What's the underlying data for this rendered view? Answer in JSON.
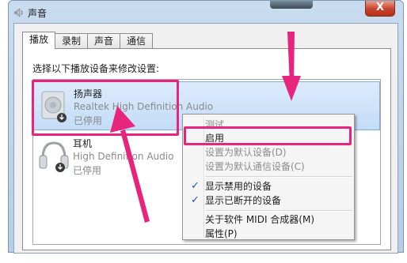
{
  "window": {
    "title": "声音",
    "close_label": "X"
  },
  "tabs": [
    {
      "label": "播放",
      "active": true
    },
    {
      "label": "录制",
      "active": false
    },
    {
      "label": "声音",
      "active": false
    },
    {
      "label": "通信",
      "active": false
    }
  ],
  "instruction": "选择以下播放设备来修改设置:",
  "devices": [
    {
      "name": "扬声器",
      "description": "Realtek High Definition Audio",
      "status": "已停用",
      "icon": "speaker-icon"
    },
    {
      "name": "耳机",
      "description": "High Definition Audio",
      "status": "已停用",
      "icon": "headphones-icon"
    }
  ],
  "context_menu": {
    "items": [
      {
        "label": "测试",
        "disabled": true
      },
      {
        "label": "启用",
        "disabled": false
      },
      {
        "label": "设置为默认设备(D)",
        "disabled": true
      },
      {
        "label": "设置为默认通信设备(C)",
        "disabled": true
      },
      {
        "label": "显示禁用的设备",
        "checked": true
      },
      {
        "label": "显示已断开的设备",
        "checked": true
      },
      {
        "label": "关于软件 MIDI 合成器(M)"
      },
      {
        "label": "属性(P)"
      }
    ]
  },
  "colors": {
    "highlight": "#e8257d",
    "selection": "#c4dcf7",
    "titlebar": "#b6cde6"
  }
}
